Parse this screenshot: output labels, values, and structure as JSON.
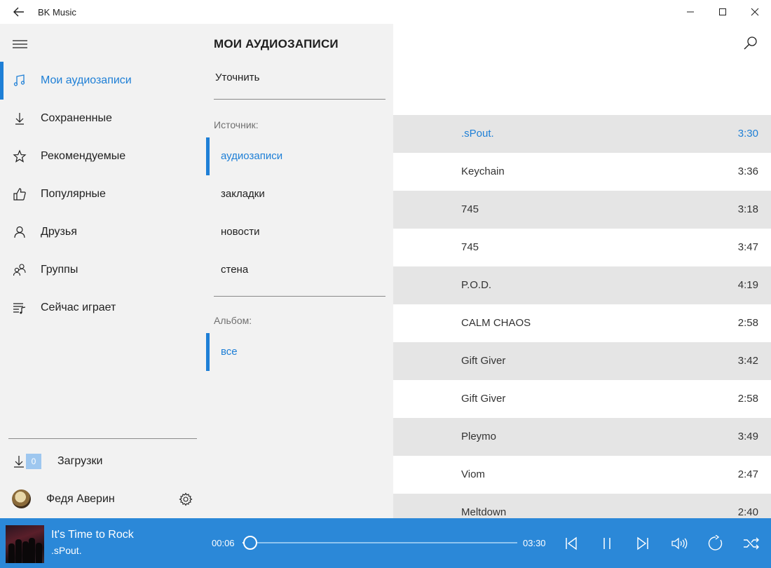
{
  "window": {
    "title": "BK Music"
  },
  "header": {
    "page_title": "МОИ АУДИОЗАПИСИ"
  },
  "sidebar": {
    "items": [
      {
        "label": "Мои аудиозаписи",
        "icon": "music-note-icon",
        "active": true
      },
      {
        "label": "Сохраненные",
        "icon": "download-arrow-icon"
      },
      {
        "label": "Рекомендуемые",
        "icon": "star-icon"
      },
      {
        "label": "Популярные",
        "icon": "thumbs-up-icon"
      },
      {
        "label": "Друзья",
        "icon": "person-icon"
      },
      {
        "label": "Группы",
        "icon": "people-icon"
      },
      {
        "label": "Сейчас играет",
        "icon": "now-playing-list-icon"
      }
    ],
    "downloads": {
      "label": "Загрузки",
      "count": "0"
    },
    "profile": {
      "name": "Федя Аверин"
    }
  },
  "filter": {
    "refine_label": "Уточнить",
    "source_caption": "Источник:",
    "sources": [
      "аудиозаписи",
      "закладки",
      "новости",
      "стена"
    ],
    "album_caption": "Альбом:",
    "albums": [
      "все"
    ]
  },
  "tracks": [
    {
      "title": ".sPout.",
      "duration": "3:30",
      "current": true
    },
    {
      "title": "Keychain",
      "duration": "3:36"
    },
    {
      "title": "745",
      "duration": "3:18"
    },
    {
      "title": "745",
      "duration": "3:47"
    },
    {
      "title": "P.O.D.",
      "duration": "4:19"
    },
    {
      "title": "CALM CHAOS",
      "duration": "2:58"
    },
    {
      "title": "Gift Giver",
      "duration": "3:42"
    },
    {
      "title": "Gift Giver",
      "duration": "2:58"
    },
    {
      "title": "Pleymo",
      "duration": "3:49"
    },
    {
      "title": "Viom",
      "duration": "2:47"
    },
    {
      "title": "Meltdown",
      "duration": "2:40"
    }
  ],
  "player": {
    "title": "It's Time to Rock",
    "artist": ".sPout.",
    "elapsed": "00:06",
    "total": "03:30",
    "progress_fraction": 0.029
  },
  "colors": {
    "accent": "#1e7fd6",
    "player_bar": "#2b88d8",
    "panel_bg": "#f2f2f2",
    "alt_row": "#e5e5e5"
  }
}
